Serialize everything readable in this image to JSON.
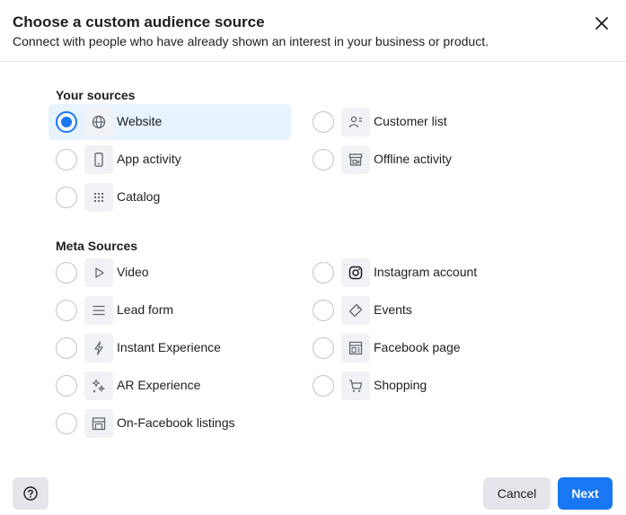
{
  "dialog": {
    "title": "Choose a custom audience source",
    "subtitle": "Connect with people who have already shown an interest in your business or product."
  },
  "sections": {
    "your_sources": {
      "heading": "Your sources",
      "options": {
        "website": {
          "label": "Website",
          "icon": "globe-icon",
          "checked": true
        },
        "customer_list": {
          "label": "Customer list",
          "icon": "contact-list-icon",
          "checked": false
        },
        "app_activity": {
          "label": "App activity",
          "icon": "mobile-phone-icon",
          "checked": false
        },
        "offline_activity": {
          "label": "Offline activity",
          "icon": "store-icon",
          "checked": false
        },
        "catalog": {
          "label": "Catalog",
          "icon": "grid-icon",
          "checked": false
        }
      }
    },
    "meta_sources": {
      "heading": "Meta Sources",
      "options": {
        "video": {
          "label": "Video",
          "icon": "play-icon",
          "checked": false
        },
        "instagram_account": {
          "label": "Instagram account",
          "icon": "instagram-icon",
          "checked": false
        },
        "lead_form": {
          "label": "Lead form",
          "icon": "lines-icon",
          "checked": false
        },
        "events": {
          "label": "Events",
          "icon": "ticket-icon",
          "checked": false
        },
        "instant_experience": {
          "label": "Instant Experience",
          "icon": "lightning-icon",
          "checked": false
        },
        "facebook_page": {
          "label": "Facebook page",
          "icon": "page-icon",
          "checked": false
        },
        "ar_experience": {
          "label": "AR Experience",
          "icon": "sparkles-icon",
          "checked": false
        },
        "shopping": {
          "label": "Shopping",
          "icon": "cart-icon",
          "checked": false
        },
        "on_facebook_listings": {
          "label": "On-Facebook listings",
          "icon": "shop-front-icon",
          "checked": false
        }
      }
    }
  },
  "footer": {
    "help_icon": "question-circle-icon",
    "cancel_label": "Cancel",
    "next_label": "Next"
  },
  "colors": {
    "accent": "#1877f2",
    "selected_bg": "#e7f3ff",
    "button_gray": "#e4e6eb",
    "icon_bg": "#f0f2f5"
  }
}
